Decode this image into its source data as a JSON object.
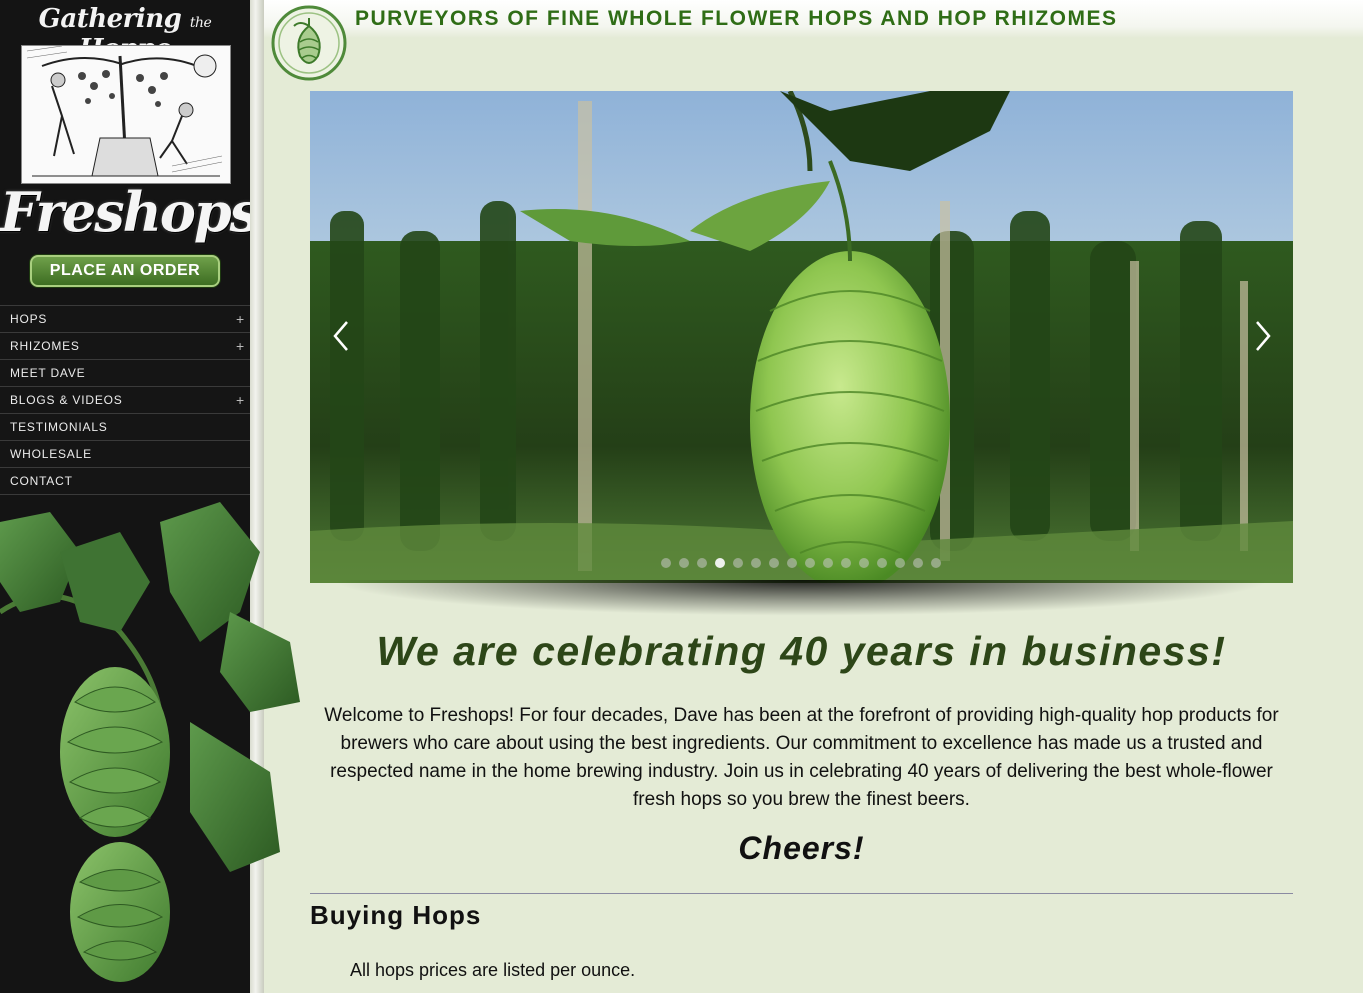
{
  "brand": {
    "top_line_left": "Gathering",
    "top_line_mid": "the",
    "top_line_right": "Hoppe",
    "name": "Freshops"
  },
  "order_button": {
    "label": "PLACE AN ORDER"
  },
  "nav": {
    "items": [
      {
        "label": "HOPS",
        "expand": "+"
      },
      {
        "label": "RHIZOMES",
        "expand": "+"
      },
      {
        "label": "MEET DAVE",
        "expand": ""
      },
      {
        "label": "BLOGS & VIDEOS",
        "expand": "+"
      },
      {
        "label": "TESTIMONIALS",
        "expand": ""
      },
      {
        "label": "WHOLESALE",
        "expand": ""
      },
      {
        "label": "CONTACT",
        "expand": ""
      }
    ]
  },
  "header": {
    "tagline": "PURVEYORS OF FINE WHOLE FLOWER HOPS AND HOP RHIZOMES"
  },
  "slider": {
    "slide_count": 16,
    "active_index": 3,
    "prev_icon": "chevron-left-icon",
    "next_icon": "chevron-right-icon"
  },
  "main": {
    "headline": "We are celebrating 40 years in business!",
    "welcome": "Welcome to Freshops! For four decades, Dave has been at the forefront of providing high-quality hop products for brewers who care about using the best ingredients. Our commitment to excellence has made us a trusted and respected name in the home brewing industry. Join us in celebrating 40 years of delivering the best whole-flower fresh hops so you brew the finest beers.",
    "cheers": "Cheers!",
    "section_title": "Buying Hops",
    "price_note": "All hops prices are listed per ounce."
  },
  "colors": {
    "page_background": "#e4ebd6",
    "sidebar_background": "#141414",
    "tagline_green": "#2f6d16",
    "headline_green": "#2d4618",
    "button_green": "#4f8430"
  }
}
